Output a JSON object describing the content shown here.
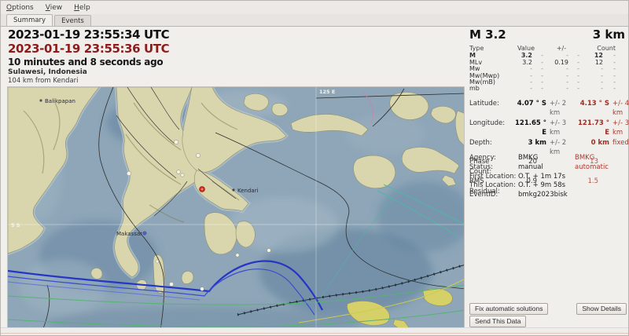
{
  "menu": {
    "items": [
      {
        "key": "O",
        "rest": "ptions"
      },
      {
        "key": "V",
        "rest": "iew"
      },
      {
        "key": "H",
        "rest": "elp"
      }
    ]
  },
  "tabs": {
    "summary": "Summary",
    "events": "Events"
  },
  "header": {
    "origin_time": "2023-01-19 23:55:34 UTC",
    "automatic_time": "2023-01-19 23:55:36 UTC",
    "elapsed": "10 minutes and 8 seconds ago",
    "region": "Sulawesi, Indonesia",
    "reference": "104 km from Kendari"
  },
  "summary_panel": {
    "magnitude": "M 3.2",
    "depth": "3 km",
    "mag_table": {
      "headers": {
        "type": "Type",
        "value": "Value",
        "error": "+/-",
        "count": "Count"
      },
      "rows": [
        [
          "M",
          "3.2",
          "-",
          "-",
          "-",
          "12",
          "-"
        ],
        [
          "MLv",
          "3.2",
          "-",
          "0.19",
          "-",
          "12",
          "-"
        ],
        [
          "Mw",
          "-",
          "-",
          "-",
          "-",
          "-",
          "-"
        ],
        [
          "Mw(Mwp)",
          "-",
          "-",
          "-",
          "-",
          "-",
          "-"
        ],
        [
          "Mw(mB)",
          "-",
          "-",
          "-",
          "-",
          "-",
          "-"
        ],
        [
          "mb",
          "-",
          "-",
          "-",
          "-",
          "-",
          "-"
        ]
      ]
    },
    "origin_table": {
      "rows": [
        {
          "label": "Latitude:",
          "manual": "4.07 ° S",
          "manual_err": "+/-  2 km",
          "auto": "4.13 ° S",
          "auto_err": "+/-  4 km"
        },
        {
          "label": "Longitude:",
          "manual": "121.65 ° E",
          "manual_err": "+/-  3 km",
          "auto": "121.73 ° E",
          "auto_err": "+/-  3 km"
        },
        {
          "label": "Depth:",
          "manual": "3 km",
          "manual_err": "+/-  2 km",
          "auto": "0 km",
          "auto_err": "fixed"
        },
        {
          "label": "Phase Count:",
          "manual": "20",
          "manual_err": "",
          "auto": "13",
          "auto_err": ""
        },
        {
          "label": "RMS Residual:",
          "manual": "0.9",
          "manual_err": "",
          "auto": "1.5",
          "auto_err": ""
        }
      ]
    },
    "meta_table": {
      "rows": [
        {
          "label": "Agency:",
          "manual": "BMKG",
          "auto": "BMKG"
        },
        {
          "label": "Status:",
          "manual": "manual",
          "auto": "automatic"
        },
        {
          "label": "First Location:",
          "manual": "O.T. + 1m 17s",
          "auto": ""
        },
        {
          "label": "This Location:",
          "manual": "O.T. + 9m 58s",
          "auto": ""
        },
        {
          "label": "EventID:",
          "manual": "bmkg2023bisk",
          "auto": ""
        }
      ]
    },
    "buttons": {
      "fix_automatic": "Fix automatic solutions",
      "show_details": "Show Details",
      "send_data": "Send This Data"
    }
  },
  "map": {
    "grid": {
      "lon_label": "125 E",
      "lat_label": "5 S"
    },
    "cities": [
      {
        "name": "Balikpapan"
      },
      {
        "name": "Kendari"
      },
      {
        "name": "Makassar"
      }
    ],
    "colors": {
      "sea": "#8ea6b8",
      "land": "#d9d6ae",
      "manual_text": "#0e0e0e",
      "automatic_red": "#a12c22",
      "header_red": "#8e1b1b",
      "plate_blue": "#2636c4",
      "epicenter_red": "#e03020"
    }
  }
}
